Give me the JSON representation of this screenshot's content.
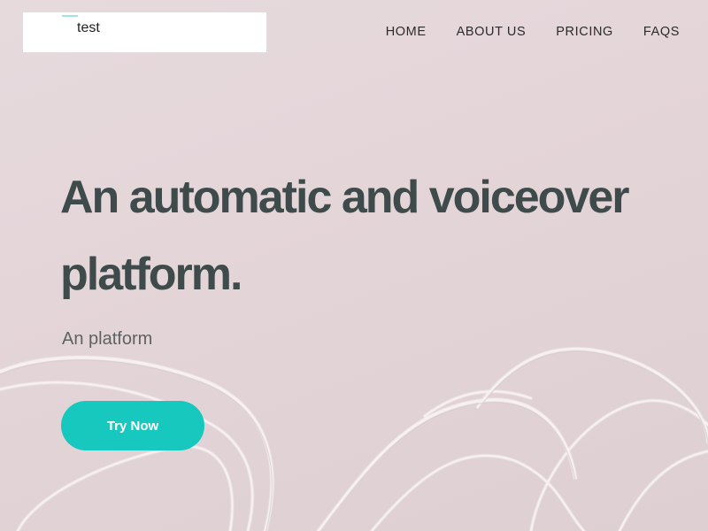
{
  "header": {
    "logo_text": "test",
    "nav": [
      "HOME",
      "ABOUT US",
      "PRICING",
      "FAQS"
    ]
  },
  "hero": {
    "headline_line1": "An automatic and voiceover",
    "headline_line2": "platform.",
    "subtitle": "An platform",
    "cta_label": "Try Now"
  },
  "colors": {
    "accent": "#16c8bd",
    "heading": "#3f4b4b",
    "background": "#e4d5d8"
  },
  "icons": [
    "earphone-cable-image"
  ]
}
